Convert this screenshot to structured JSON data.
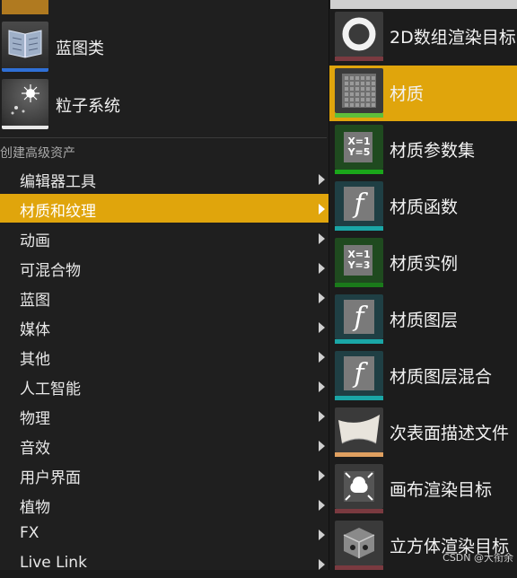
{
  "assets": [
    {
      "label": "蓝图类",
      "icon": "blueprint-book-icon"
    },
    {
      "label": "粒子系统",
      "icon": "particle-sparkle-icon"
    }
  ],
  "section_title": "创建高级资产",
  "menu": [
    {
      "label": "编辑器工具"
    },
    {
      "label": "材质和纹理",
      "active": true
    },
    {
      "label": "动画"
    },
    {
      "label": "可混合物"
    },
    {
      "label": "蓝图"
    },
    {
      "label": "媒体"
    },
    {
      "label": "其他"
    },
    {
      "label": "人工智能"
    },
    {
      "label": "物理"
    },
    {
      "label": "音效"
    },
    {
      "label": "用户界面"
    },
    {
      "label": "植物"
    },
    {
      "label": "FX"
    },
    {
      "label": "Live Link"
    }
  ],
  "submenu": [
    {
      "label": "2D数组渲染目标",
      "icon": "ring-icon",
      "bar_color": "#7a3a40"
    },
    {
      "label": "材质",
      "icon": "material-grid-icon",
      "bar_color": "#5fbf3a",
      "active": true
    },
    {
      "label": "材质参数集",
      "icon": "parameter-collection-icon",
      "glyph": "X=1\nY=5",
      "bar_color": "#1aa61a"
    },
    {
      "label": "材质函数",
      "icon": "function-icon",
      "glyph": "f",
      "bar_color": "#1aa6a6"
    },
    {
      "label": "材质实例",
      "icon": "material-instance-icon",
      "glyph": "X=1\nY=3",
      "bar_color": "#1a7a1a"
    },
    {
      "label": "材质图层",
      "icon": "function-icon",
      "glyph": "f",
      "bar_color": "#1aa6a6"
    },
    {
      "label": "材质图层混合",
      "icon": "function-icon",
      "glyph": "f",
      "bar_color": "#1aa6a6"
    },
    {
      "label": "次表面描述文件",
      "icon": "subsurface-icon",
      "bar_color": "#e0a060"
    },
    {
      "label": "画布渲染目标",
      "icon": "canvas-target-icon",
      "bar_color": "#7a3a40"
    },
    {
      "label": "立方体渲染目标",
      "icon": "cube-target-icon",
      "bar_color": "#7a3a40"
    }
  ],
  "watermark": "CSDN @大衔余"
}
